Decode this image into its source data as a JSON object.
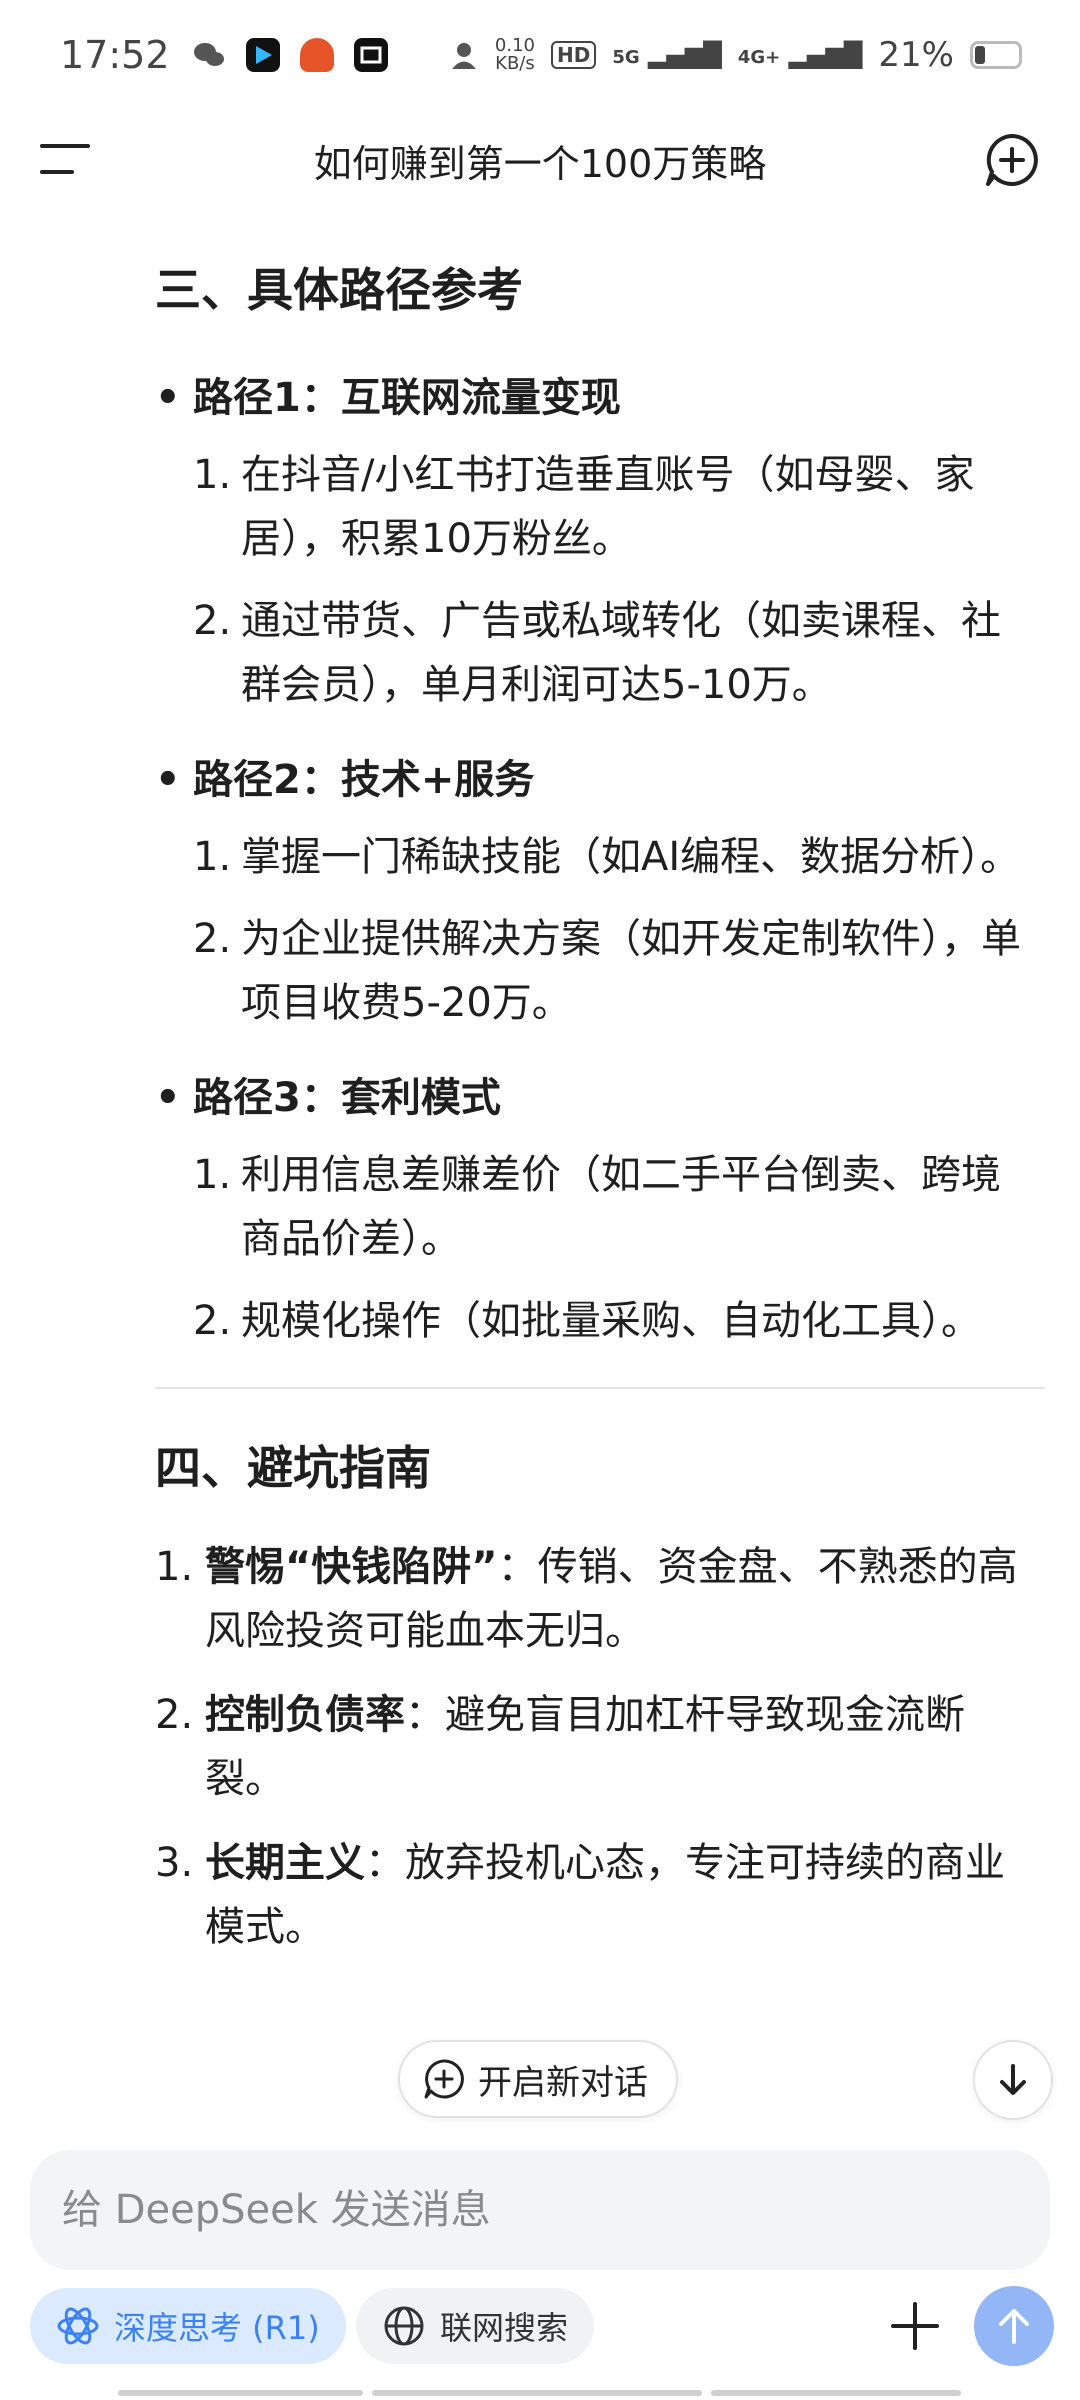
{
  "status_bar": {
    "time": "17:52",
    "net_speed_value": "0.10",
    "net_speed_unit": "KB/s",
    "hd_label": "HD",
    "sig1_label": "5G",
    "sig2_label": "4G+",
    "battery": "21%"
  },
  "header": {
    "title": "如何赚到第一个100万策略"
  },
  "content": {
    "section3": {
      "heading": "三、具体路径参考",
      "paths": [
        {
          "title": "路径1：互联网流量变现",
          "items": [
            {
              "num": "1.",
              "text": "在抖音/小红书打造垂直账号（如母婴、家居），积累10万粉丝。"
            },
            {
              "num": "2.",
              "text": "通过带货、广告或私域转化（如卖课程、社群会员），单月利润可达5-10万。"
            }
          ]
        },
        {
          "title": "路径2：技术+服务",
          "items": [
            {
              "num": "1.",
              "text": "掌握一门稀缺技能（如AI编程、数据分析）。"
            },
            {
              "num": "2.",
              "text": "为企业提供解决方案（如开发定制软件），单项目收费5-20万。"
            }
          ]
        },
        {
          "title": "路径3：套利模式",
          "items": [
            {
              "num": "1.",
              "text": "利用信息差赚差价（如二手平台倒卖、跨境商品价差）。"
            },
            {
              "num": "2.",
              "text": "规模化操作（如批量采购、自动化工具）。"
            }
          ]
        }
      ]
    },
    "section4": {
      "heading": "四、避坑指南",
      "tips": [
        {
          "num": "1.",
          "bold": "警惕“快钱陷阱”",
          "text": "：传销、资金盘、不熟悉的高风险投资可能血本无归。"
        },
        {
          "num": "2.",
          "bold": "控制负债率",
          "text": "：避免盲目加杠杆导致现金流断裂。"
        },
        {
          "num": "3.",
          "bold": "长期主义",
          "text": "：放弃投机心态，专注可持续的商业模式。"
        }
      ]
    }
  },
  "floating": {
    "new_chat_label": "开启新对话"
  },
  "composer": {
    "placeholder": "给 DeepSeek 发送消息"
  },
  "toolbar": {
    "deep_think_label": "深度思考 (R1)",
    "web_search_label": "联网搜索"
  },
  "colors": {
    "accent": "#3b82f6",
    "accent_bg": "#dbeafe",
    "send_bg": "#93b6f7",
    "text": "#1f1f1f"
  },
  "icons": [
    "menu-icon",
    "new-chat-icon",
    "arrow-down-icon",
    "atom-icon",
    "globe-icon",
    "plus-icon",
    "arrow-up-icon"
  ]
}
